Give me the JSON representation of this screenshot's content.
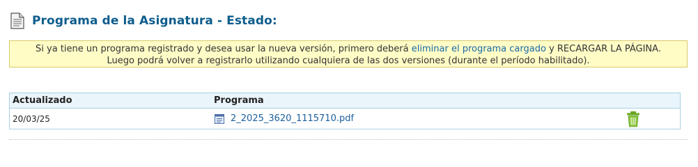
{
  "header": {
    "icon": "document-icon",
    "title": "Programa de la Asignatura - Estado:"
  },
  "notice": {
    "text_before": "Si ya tiene un programa registrado y desea usar la nueva versión, primero deberá ",
    "link_text": "eliminar el programa cargado",
    "text_after": " y RECARGAR LA PÁGINA.",
    "line2": "Luego podrá volver a registrarlo utilizando cualquiera de las dos versiones (durante el período habilitado)."
  },
  "table": {
    "columns": [
      "Actualizado",
      "Programa"
    ],
    "rows": [
      {
        "date": "20/03/25",
        "file_name": "2_2025_3620_1115710.pdf",
        "file_icon": "file-document-icon",
        "delete_icon": "trash-icon"
      }
    ]
  },
  "colors": {
    "title": "#0e5d8d",
    "link": "#1a6aa8",
    "notice_bg": "#fffcc6",
    "notice_border": "#d9c96a",
    "table_border": "#a9cfe3",
    "table_header_bg": "#eaf5fb",
    "trash": "#7ab52a"
  }
}
